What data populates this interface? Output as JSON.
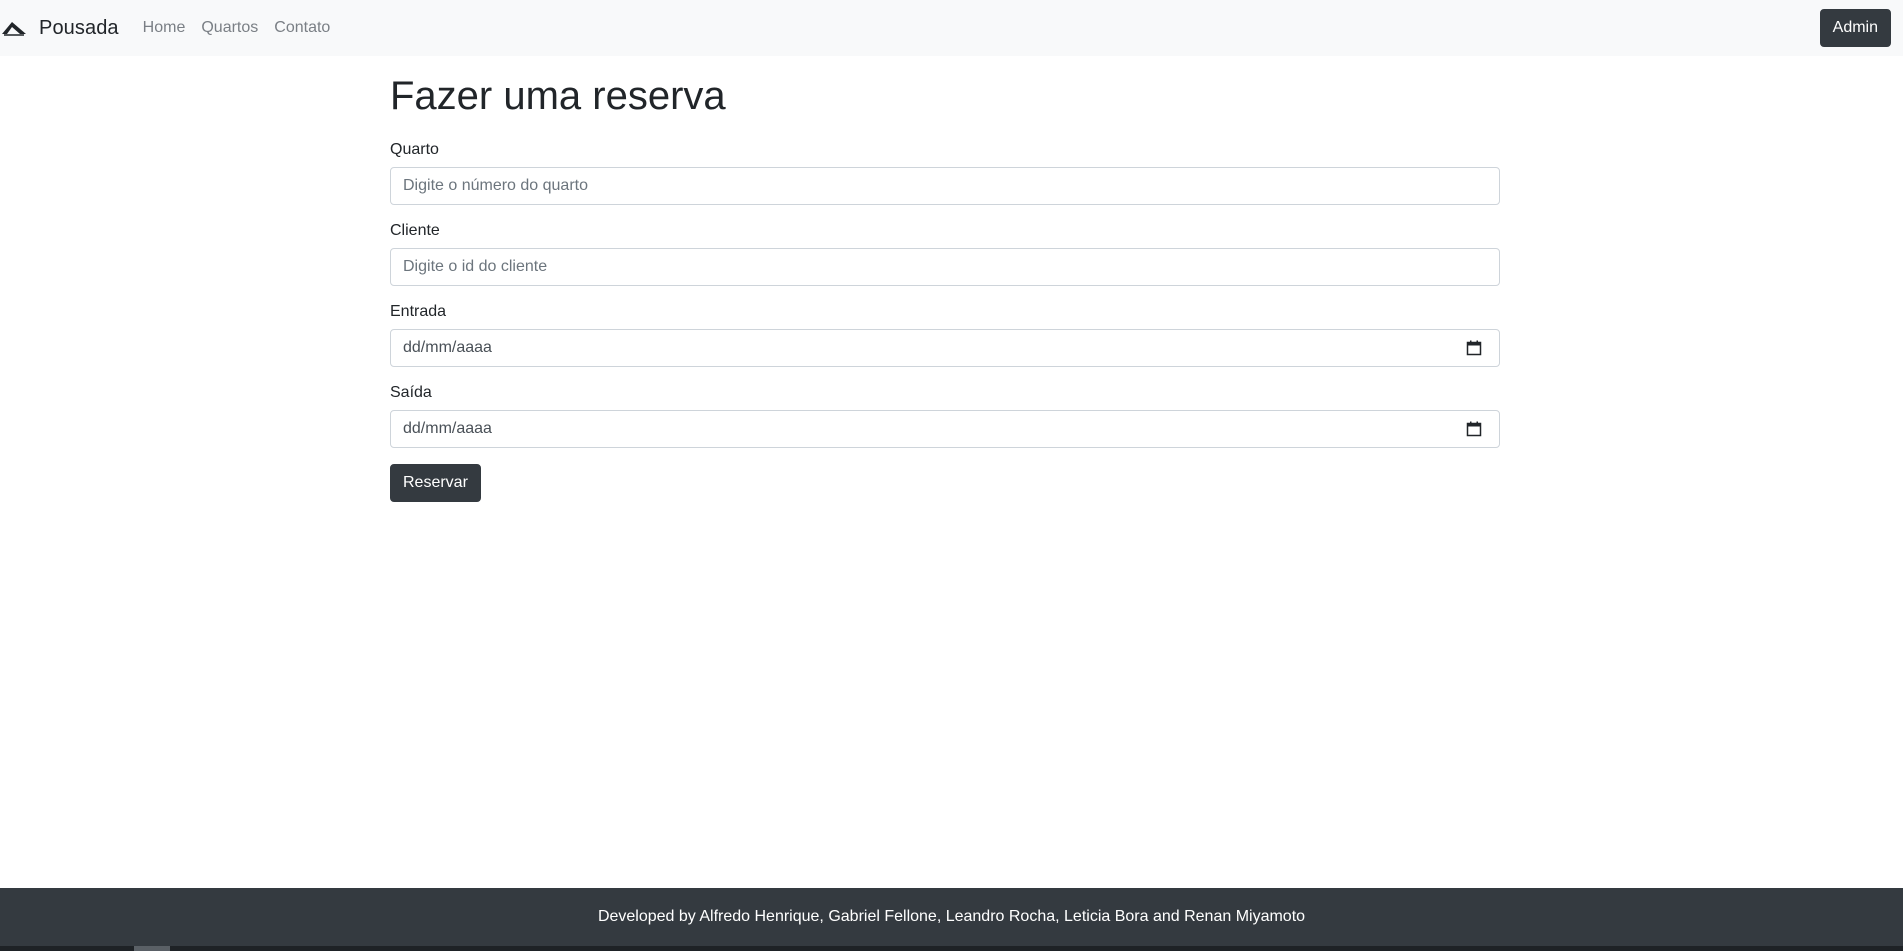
{
  "navbar": {
    "brand": "Pousada",
    "links": [
      "Home",
      "Quartos",
      "Contato"
    ],
    "admin_label": "Admin"
  },
  "form": {
    "title": "Fazer uma reserva",
    "quarto": {
      "label": "Quarto",
      "placeholder": "Digite o número do quarto"
    },
    "cliente": {
      "label": "Cliente",
      "placeholder": "Digite o id do cliente"
    },
    "entrada": {
      "label": "Entrada",
      "value": "dd/mm/aaaa"
    },
    "saida": {
      "label": "Saída",
      "value": "dd/mm/aaaa"
    },
    "submit_label": "Reservar"
  },
  "footer": {
    "text": "Developed by Alfredo Henrique, Gabriel Fellone, Leandro Rocha, Leticia Bora and Renan Miyamoto"
  },
  "colors": {
    "navbar_bg": "#f8f9fa",
    "dark": "#343a40",
    "muted_link": "#7a7f85",
    "border": "#ced4da"
  },
  "icons": {
    "brand": "mountain-logo-icon",
    "date": "calendar-icon"
  }
}
